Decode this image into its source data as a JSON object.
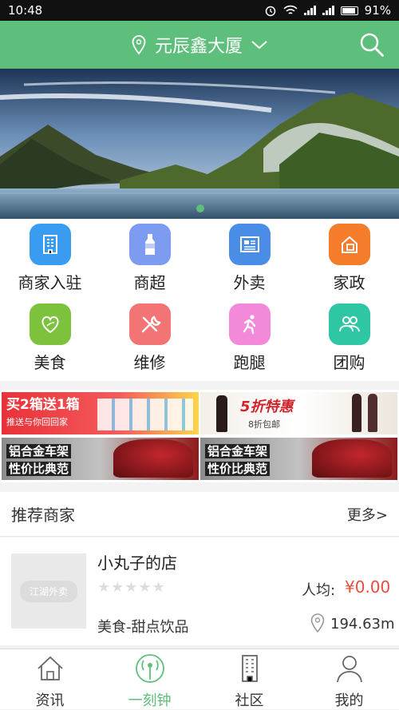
{
  "status": {
    "time": "10:48",
    "battery": "91%"
  },
  "header": {
    "location": "元辰鑫大厦"
  },
  "categories": [
    {
      "label": "商家入驻",
      "icon": "building-icon",
      "color": "#3a9cf0"
    },
    {
      "label": "商超",
      "icon": "bottle-icon",
      "color": "#7e9bf2"
    },
    {
      "label": "外卖",
      "icon": "newspaper-icon",
      "color": "#4a8de6"
    },
    {
      "label": "家政",
      "icon": "house-cleaning-icon",
      "color": "#f57c2b"
    },
    {
      "label": "美食",
      "icon": "leaf-heart-icon",
      "color": "#7cc23c"
    },
    {
      "label": "维修",
      "icon": "tools-icon",
      "color": "#f27474"
    },
    {
      "label": "跑腿",
      "icon": "running-man-icon",
      "color": "#f28ad9"
    },
    {
      "label": "团购",
      "icon": "people-icon",
      "color": "#2fc6a3"
    }
  ],
  "ads": [
    {
      "text1": "买2箱送1箱",
      "text2": "推送与你回回家"
    },
    {
      "text1": "5折特惠",
      "text2": "8折包邮"
    },
    {
      "text1": "铝合金车架",
      "text2": "性价比典范"
    },
    {
      "text1": "铝合金车架",
      "text2": "性价比典范"
    }
  ],
  "recommend": {
    "title": "推荐商家",
    "more": "更多>"
  },
  "shop": {
    "name": "小丸子的店",
    "thumb_label": "江湖外卖",
    "avg_label": "人均:",
    "avg_price": "¥0.00",
    "category": "美食-甜点饮品",
    "distance": "194.63m",
    "rating": 0
  },
  "tabs": [
    {
      "label": "资讯",
      "icon": "house-icon"
    },
    {
      "label": "一刻钟",
      "icon": "signal-tower-icon"
    },
    {
      "label": "社区",
      "icon": "apartment-building-icon"
    },
    {
      "label": "我的",
      "icon": "user-icon"
    }
  ],
  "colors": {
    "brand": "#5ebf7c",
    "price": "#e84d3d"
  }
}
